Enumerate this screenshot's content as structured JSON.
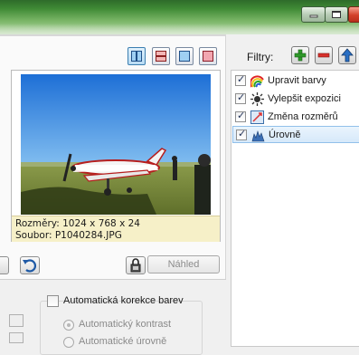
{
  "window": {
    "minimize_icon": "minimize-icon",
    "maximize_icon": "maximize-icon",
    "close_icon": "close-icon"
  },
  "toolbar": {
    "view_buttons": [
      "view-side-by-side-icon",
      "view-top-bottom-icon",
      "view-original-icon",
      "view-result-icon"
    ]
  },
  "preview": {
    "size_line": "Rozměry: 1024 x 768 x 24",
    "file_line": "Soubor: P1040284.JPG"
  },
  "actions": {
    "nahled_label": "Náhled"
  },
  "filters": {
    "label": "Filtry:",
    "items": [
      {
        "label": "Upravit barvy",
        "checked": true,
        "icon": "rainbow-icon"
      },
      {
        "label": "Vylepšit expozici",
        "checked": true,
        "icon": "sun-icon"
      },
      {
        "label": "Změna rozměrů",
        "checked": true,
        "icon": "resize-icon"
      },
      {
        "label": "Úrovně",
        "checked": true,
        "icon": "levels-icon",
        "selected": true
      }
    ]
  },
  "auto_correction": {
    "checkbox_label": "Automatická korekce barev",
    "radio_contrast": "Automatický kontrast",
    "radio_levels": "Automatické úrovně"
  },
  "colors": {
    "titlebar": "#3f8a35",
    "selection": "#d6e9fa",
    "info_bg": "#f6f0c8"
  }
}
